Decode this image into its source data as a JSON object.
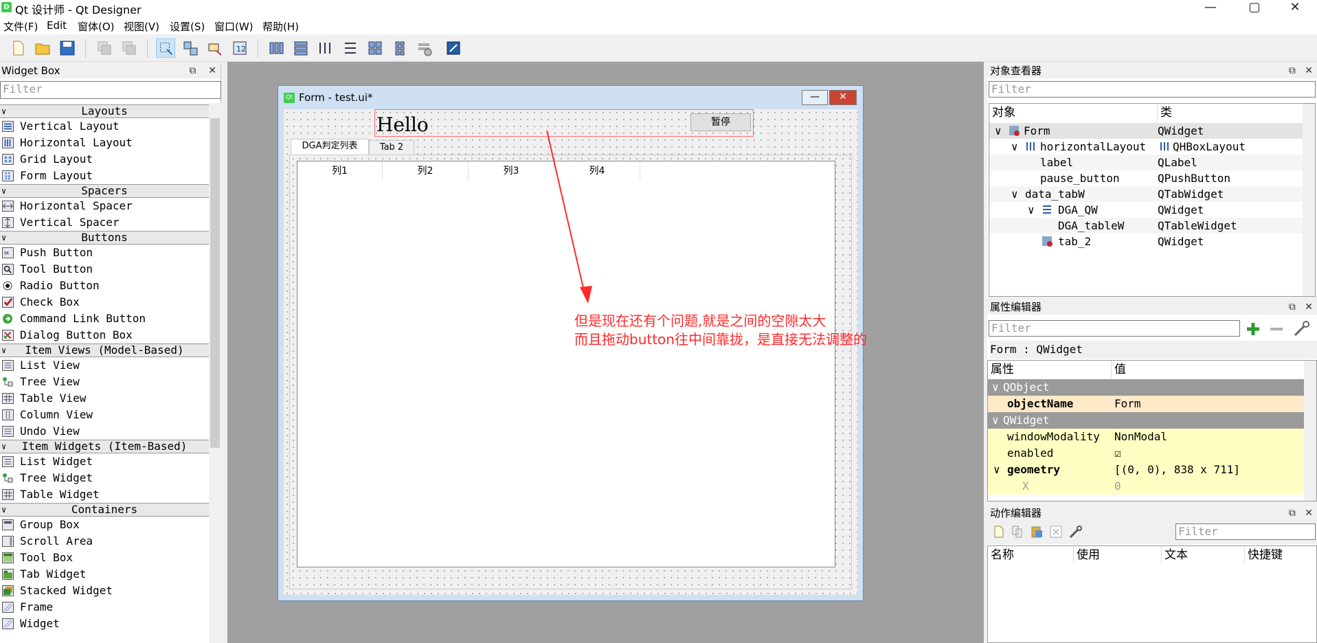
{
  "window": {
    "title": "Qt 设计师 - Qt Designer",
    "app_icon": "D"
  },
  "window_controls": {
    "minimize": "—",
    "maximize": "▢",
    "close": "✕"
  },
  "menu": [
    "文件(F)",
    "Edit",
    "窗体(O)",
    "视图(V)",
    "设置(S)",
    "窗口(W)",
    "帮助(H)"
  ],
  "widget_box": {
    "title": "Widget Box",
    "filter_placeholder": "Filter",
    "categories": {
      "layouts": "Layouts",
      "spacers": "Spacers",
      "buttons": "Buttons",
      "item_views": "Item Views (Model-Based)",
      "item_widgets": "Item Widgets (Item-Based)",
      "containers": "Containers"
    },
    "items": {
      "vertical_layout": "Vertical Layout",
      "horizontal_layout": "Horizontal Layout",
      "grid_layout": "Grid Layout",
      "form_layout": "Form Layout",
      "horizontal_spacer": "Horizontal Spacer",
      "vertical_spacer": "Vertical Spacer",
      "push_button": "Push Button",
      "tool_button": "Tool Button",
      "radio_button": "Radio Button",
      "check_box": "Check Box",
      "command_link_button": "Command Link Button",
      "dialog_button_box": "Dialog Button Box",
      "list_view": "List View",
      "tree_view": "Tree View",
      "table_view": "Table View",
      "column_view": "Column View",
      "undo_view": "Undo View",
      "list_widget": "List Widget",
      "tree_widget": "Tree Widget",
      "table_widget": "Table Widget",
      "group_box": "Group Box",
      "scroll_area": "Scroll Area",
      "tool_box": "Tool Box",
      "tab_widget": "Tab Widget",
      "stacked_widget": "Stacked Widget",
      "frame": "Frame",
      "widget": "Widget"
    }
  },
  "form": {
    "title": "Form - test.ui*",
    "qt_icon": "Qt",
    "label_text": "Hello",
    "pause_button": "暂停",
    "tabs": [
      "DGA判定列表",
      "Tab 2"
    ],
    "table_columns": [
      "列1",
      "列2",
      "列3",
      "列4"
    ]
  },
  "annotation": {
    "line1": "但是现在还有个问题,就是之间的空隙太大",
    "line2": "而且拖动button往中间靠拢，是直接无法调整的",
    "color": "#ff2a2a"
  },
  "object_inspector": {
    "title": "对象查看器",
    "filter_placeholder": "Filter",
    "col_object": "对象",
    "col_class": "类",
    "rows": [
      {
        "name": "Form",
        "class": "QWidget"
      },
      {
        "name": "horizontalLayout",
        "class": "QHBoxLayout"
      },
      {
        "name": "label",
        "class": "QLabel"
      },
      {
        "name": "pause_button",
        "class": "QPushButton"
      },
      {
        "name": "data_tabW",
        "class": "QTabWidget"
      },
      {
        "name": "DGA_QW",
        "class": "QWidget"
      },
      {
        "name": "DGA_tableW",
        "class": "QTableWidget"
      },
      {
        "name": "tab_2",
        "class": "QWidget"
      }
    ]
  },
  "property_editor": {
    "title": "属性编辑器",
    "filter_placeholder": "Filter",
    "context": "Form : QWidget",
    "col_property": "属性",
    "col_value": "值",
    "group_qobject": "QObject",
    "group_qwidget": "QWidget",
    "object_name_key": "objectName",
    "object_name_value": "Form",
    "window_modality_key": "windowModality",
    "window_modality_value": "NonModal",
    "enabled_key": "enabled",
    "enabled_value": "☑",
    "geometry_key": "geometry",
    "geometry_value": "[(0, 0), 838 x 711]",
    "x_key": "X",
    "x_value": "0"
  },
  "action_editor": {
    "title": "动作编辑器",
    "filter_placeholder": "Filter",
    "columns": [
      "名称",
      "使用",
      "文本",
      "快捷键"
    ]
  },
  "dock_buttons": {
    "float": "⧉",
    "close": "✕"
  }
}
